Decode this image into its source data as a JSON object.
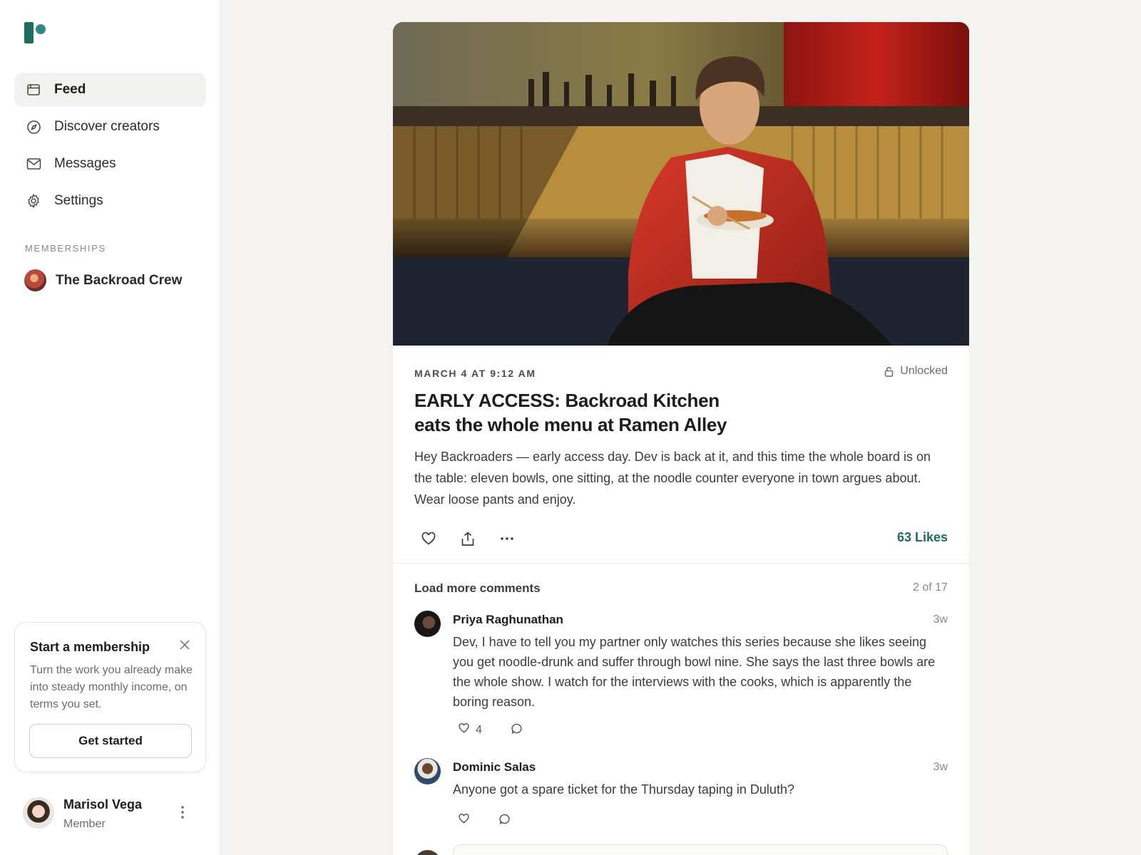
{
  "brand": {
    "accent": "#1f6b5f",
    "logo_icon": "patreon-logo-icon"
  },
  "sidebar": {
    "nav": [
      {
        "label": "Feed",
        "icon": "feed-icon",
        "active": true
      },
      {
        "label": "Discover creators",
        "icon": "compass-icon",
        "active": false
      },
      {
        "label": "Messages",
        "icon": "mail-icon",
        "active": false
      },
      {
        "label": "Settings",
        "icon": "gear-icon",
        "active": false
      }
    ],
    "memberships_label": "MEMBERSHIPS",
    "memberships": [
      {
        "name": "The Backroad Crew"
      }
    ],
    "promo": {
      "title": "Start a membership",
      "text": "Turn the work you already make into steady monthly income, on terms you set.",
      "button": "Get started"
    },
    "user": {
      "name": "Marisol Vega",
      "role": "Member"
    }
  },
  "post": {
    "date": "MARCH 4 AT 9:12 AM",
    "status": "Unlocked",
    "title": "EARLY ACCESS: Backroad Kitchen eats the whole menu at Ramen Alley",
    "body": "Hey Backroaders — early access day. Dev is back at it, and this time the whole board is on the table: eleven bowls, one sitting, at the noodle counter everyone in town argues about. Wear loose pants and enjoy.",
    "likes": "63 Likes"
  },
  "comments_section": {
    "load_more": "Load more comments",
    "count": "2 of 17",
    "comments": [
      {
        "author": "Priya Raghunathan",
        "time": "3w",
        "text": "Dev, I have to tell you my partner only watches this series because she likes seeing you get noodle-drunk and suffer through bowl nine. She says the last three bowls are the whole show. I watch for the interviews with the cooks, which is apparently the boring reason.",
        "likes": "4"
      },
      {
        "author": "Dominic Salas",
        "time": "3w",
        "text": "Anyone got a spare ticket for the Thursday taping in Duluth?",
        "likes": ""
      }
    ]
  }
}
